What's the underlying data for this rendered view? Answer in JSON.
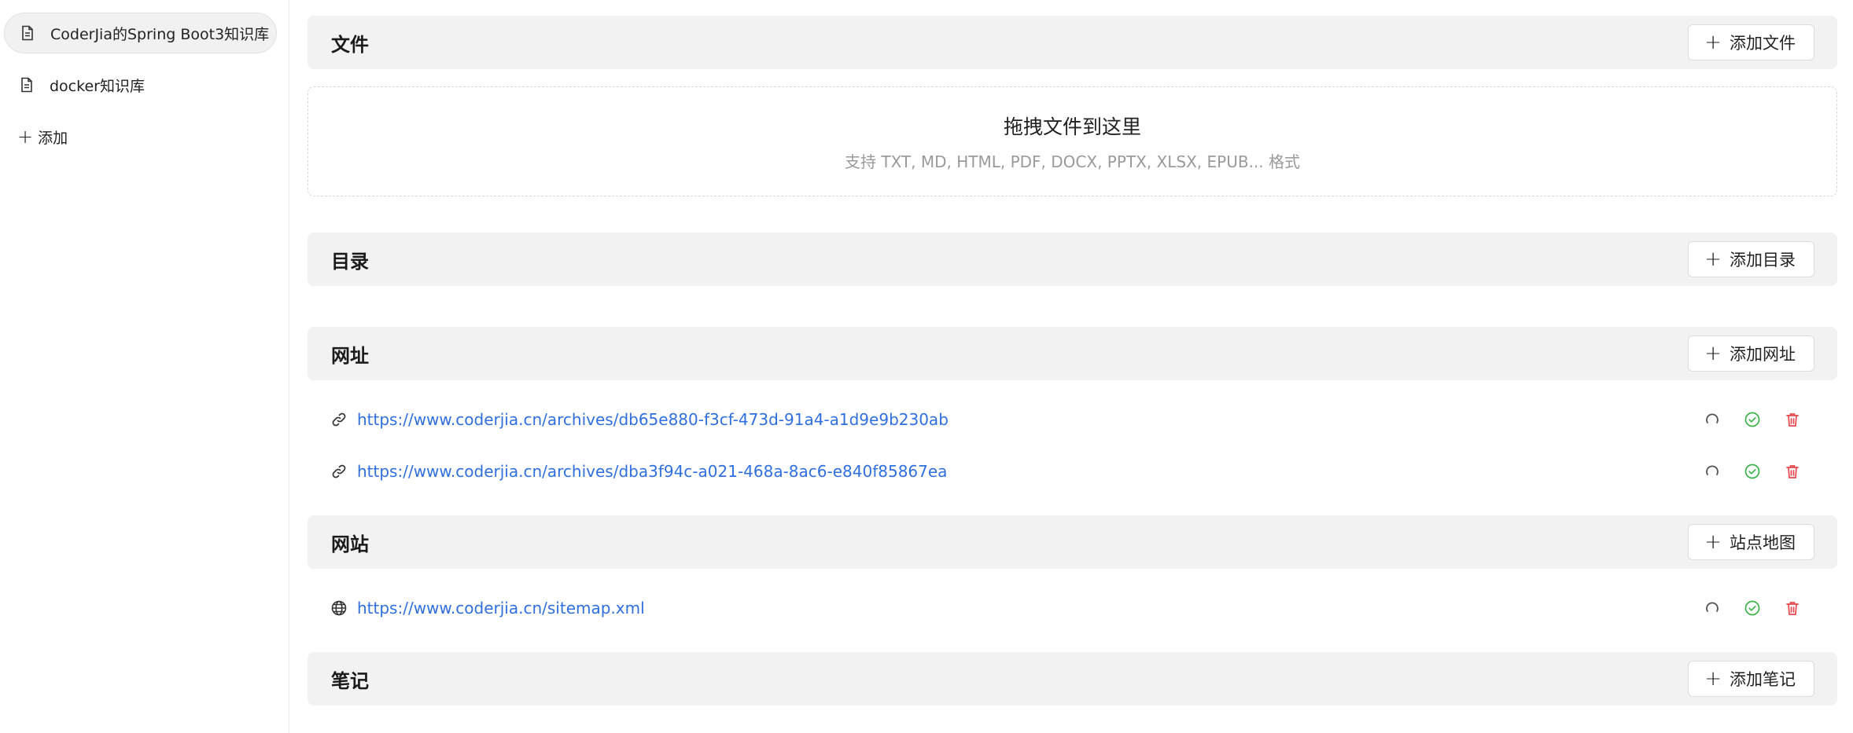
{
  "sidebar": {
    "items": [
      {
        "label": "CoderJia的Spring Boot3知识库",
        "icon": "document-icon",
        "active": true
      },
      {
        "label": "docker知识库",
        "icon": "document-icon",
        "active": false
      }
    ],
    "add_label": "添加"
  },
  "sections": {
    "files": {
      "title": "文件",
      "button": "添加文件"
    },
    "dropzone": {
      "title": "拖拽文件到这里",
      "subtitle": "支持 TXT, MD, HTML, PDF, DOCX, PPTX, XLSX, EPUB... 格式"
    },
    "directory": {
      "title": "目录",
      "button": "添加目录"
    },
    "urls": {
      "title": "网址",
      "button": "添加网址",
      "items": [
        "https://www.coderjia.cn/archives/db65e880-f3cf-473d-91a4-a1d9e9b230ab",
        "https://www.coderjia.cn/archives/dba3f94c-a021-468a-8ac6-e840f85867ea"
      ]
    },
    "sites": {
      "title": "网站",
      "button": "站点地图",
      "items": [
        "https://www.coderjia.cn/sitemap.xml"
      ]
    },
    "notes": {
      "title": "笔记",
      "button": "添加笔记"
    }
  },
  "colors": {
    "link": "#2f6fdf",
    "success": "#3bb34a",
    "danger": "#e5484d",
    "header_bg": "#f2f2f2"
  }
}
